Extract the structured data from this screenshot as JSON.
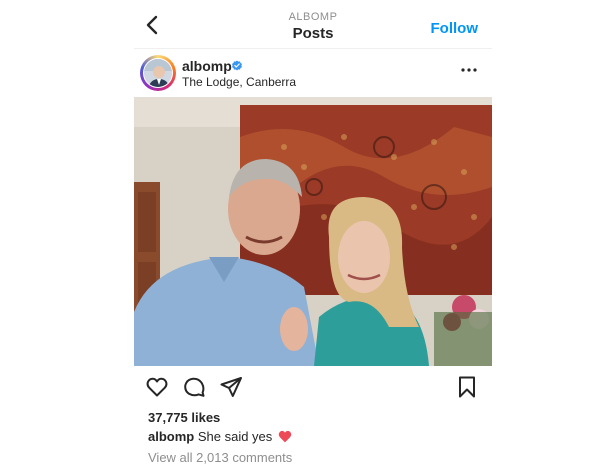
{
  "header": {
    "account_caps": "ALBOMP",
    "title": "Posts",
    "follow_label": "Follow"
  },
  "post": {
    "username": "albomp",
    "location": "The Lodge, Canberra",
    "likes": "37,775 likes",
    "caption_user": "albomp",
    "caption_text": "She said yes",
    "view_comments": "View all 2,013 comments"
  },
  "colors": {
    "accent": "#0095f6",
    "verified": "#3897f0",
    "heart": "#ed4956"
  },
  "icons": [
    "back-chevron-icon",
    "verified-badge-icon",
    "more-options-icon",
    "heart-icon",
    "comment-icon",
    "share-icon",
    "bookmark-icon",
    "red-heart-emoji"
  ]
}
